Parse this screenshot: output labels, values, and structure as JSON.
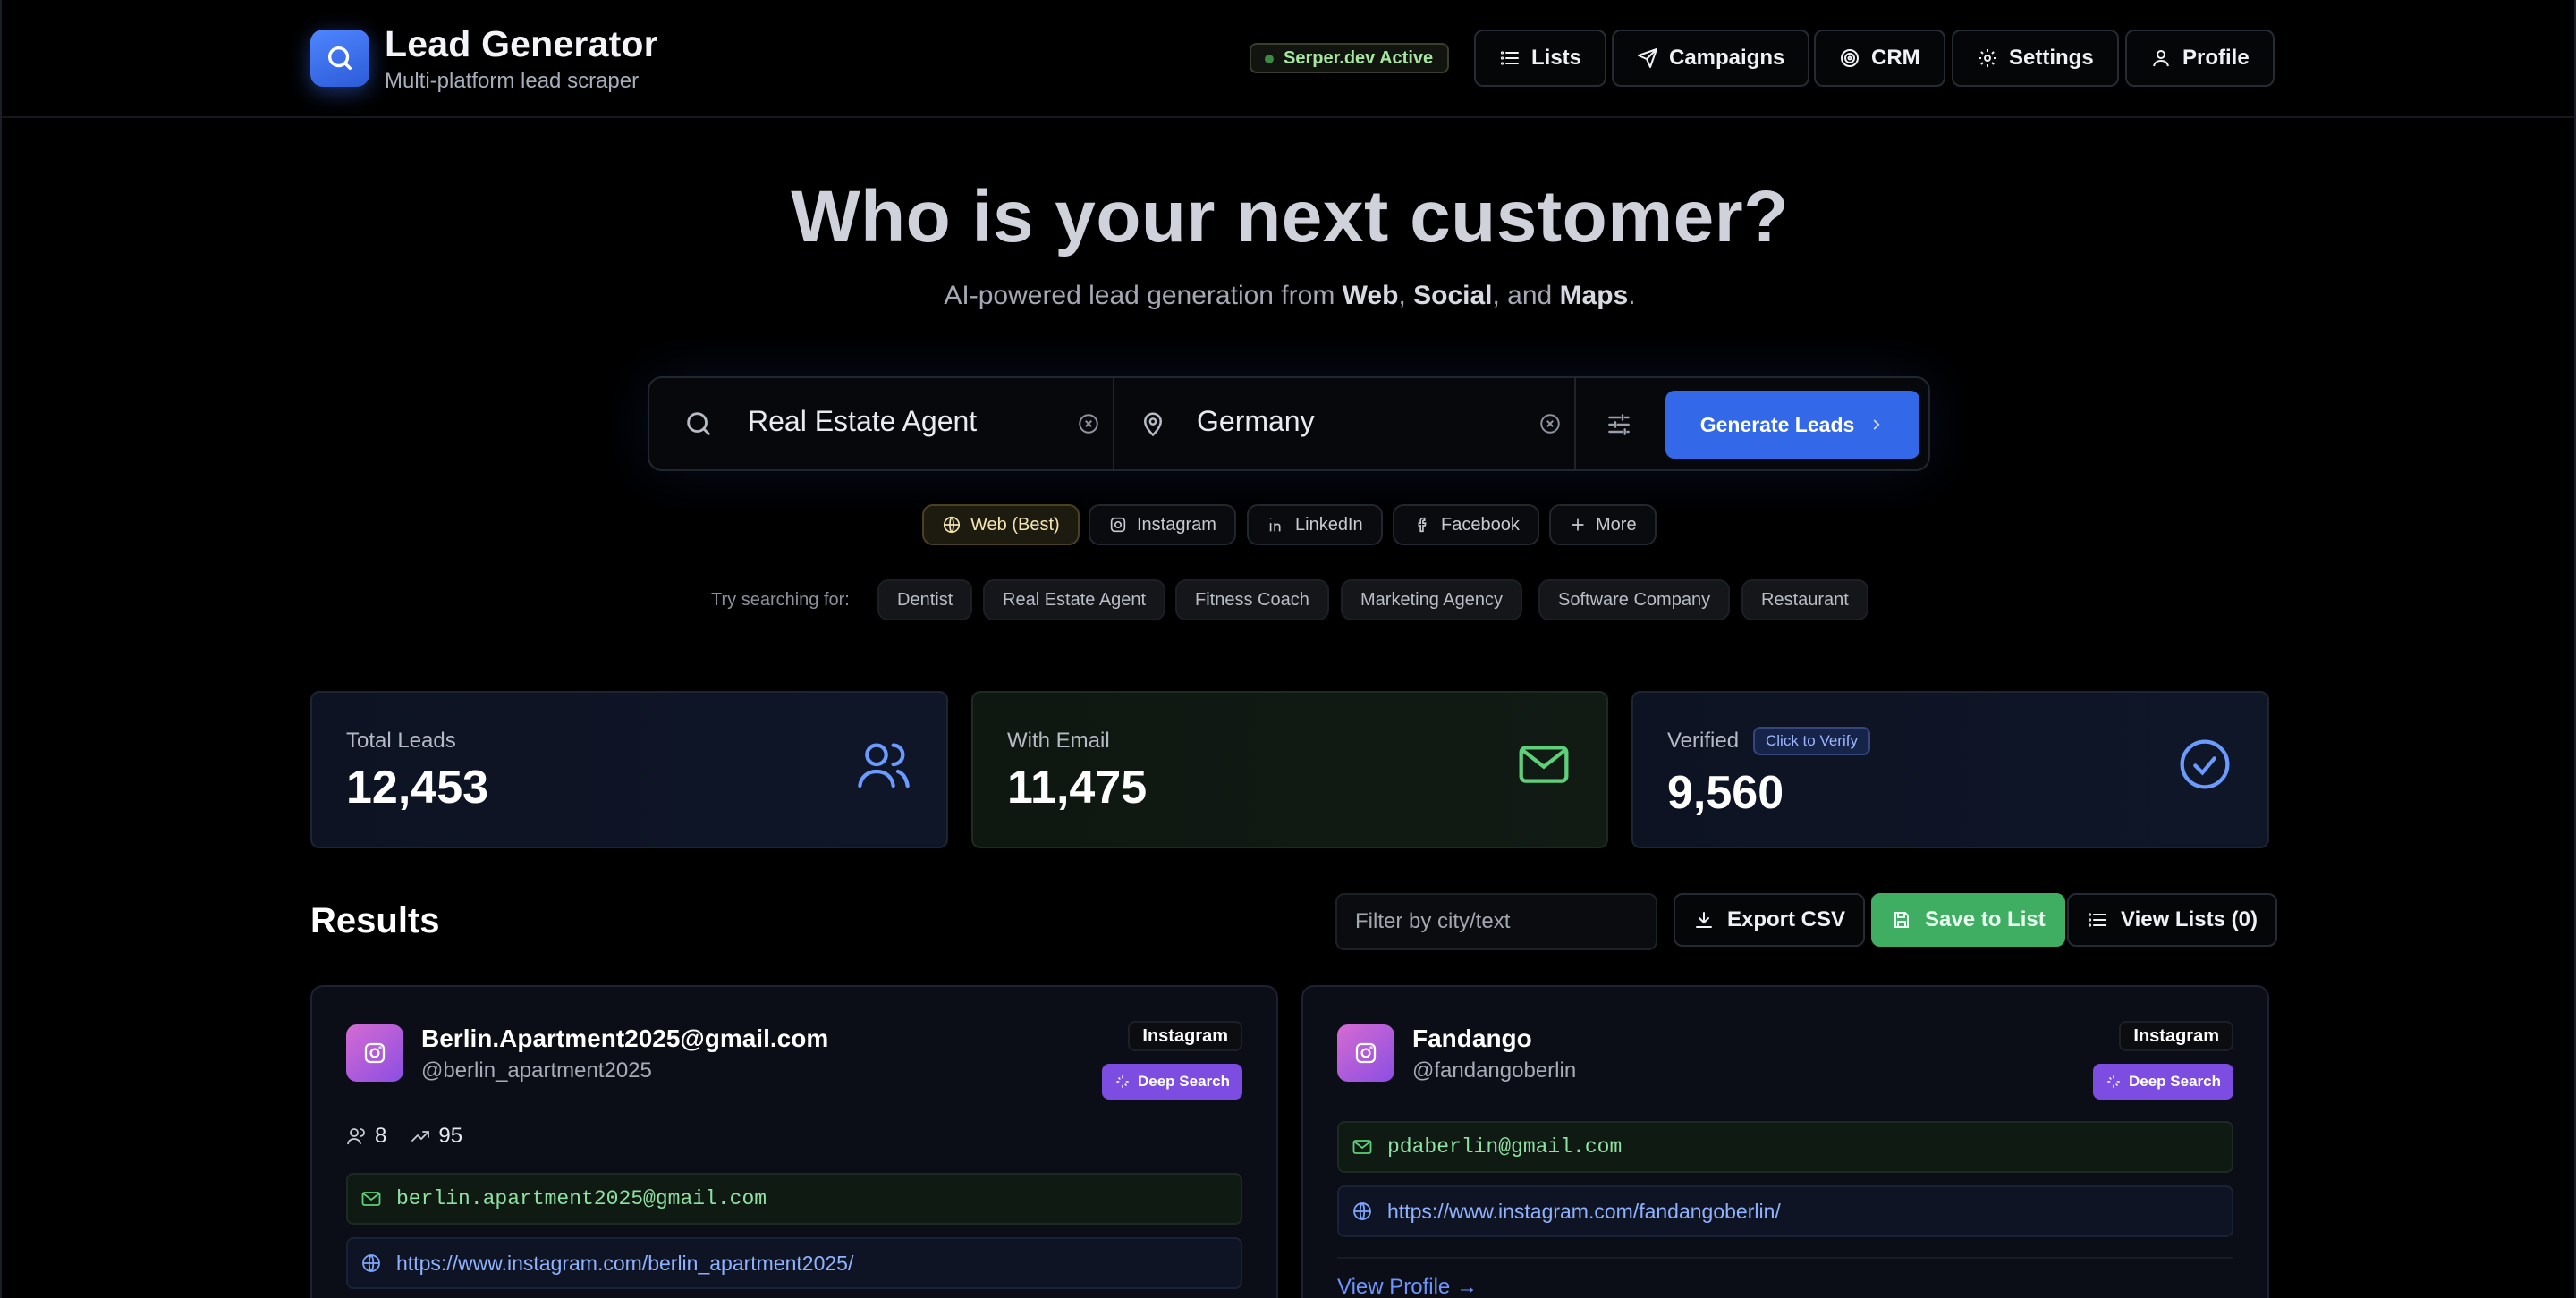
{
  "header": {
    "title": "Lead Generator",
    "subtitle": "Multi-platform lead scraper",
    "status": "Serper.dev Active",
    "nav": [
      {
        "label": "Lists",
        "icon": "list-icon"
      },
      {
        "label": "Campaigns",
        "icon": "send-icon"
      },
      {
        "label": "CRM",
        "icon": "target-icon"
      },
      {
        "label": "Settings",
        "icon": "gear-icon"
      },
      {
        "label": "Profile",
        "icon": "user-icon"
      }
    ]
  },
  "hero": {
    "title": "Who is your next customer?",
    "sub_prefix": "AI-powered lead generation from ",
    "sub_web": "Web",
    "sub_comma": ", ",
    "sub_social": "Social",
    "sub_and": ", and ",
    "sub_maps": "Maps",
    "sub_end": "."
  },
  "search": {
    "query": "Real Estate Agent",
    "location": "Germany",
    "button": "Generate Leads"
  },
  "platforms": [
    {
      "label": "Web (Best)",
      "active": true
    },
    {
      "label": "Instagram"
    },
    {
      "label": "LinkedIn"
    },
    {
      "label": "Facebook"
    },
    {
      "label": "More"
    }
  ],
  "suggestions": {
    "label": "Try searching for:",
    "items": [
      "Dentist",
      "Real Estate Agent",
      "Fitness Coach",
      "Marketing Agency",
      "Software Company",
      "Restaurant"
    ]
  },
  "stats": {
    "total": {
      "label": "Total Leads",
      "value": "12,453"
    },
    "email": {
      "label": "With Email",
      "value": "11,475"
    },
    "verified": {
      "label": "Verified",
      "chip": "Click to Verify",
      "value": "9,560"
    }
  },
  "results": {
    "title": "Results",
    "filter_placeholder": "Filter by city/text",
    "export": "Export CSV",
    "save": "Save to List",
    "view_lists": "View Lists (0)"
  },
  "cards": [
    {
      "name": "Berlin.Apartment2025@gmail.com",
      "handle": "@berlin_apartment2025",
      "source": "Instagram",
      "deep": "Deep Search",
      "followers": "8",
      "score": "95",
      "email": "berlin.apartment2025@gmail.com",
      "url": "https://www.instagram.com/berlin_apartment2025/"
    },
    {
      "name": "Fandango",
      "handle": "@fandangoberlin",
      "source": "Instagram",
      "deep": "Deep Search",
      "email": "pdaberlin@gmail.com",
      "url": "https://www.instagram.com/fandangoberlin/",
      "view_profile": "View Profile →"
    }
  ],
  "colors": {
    "accent": "#3368e8",
    "success": "#3fae62",
    "deep_search": "#7c4de0"
  }
}
